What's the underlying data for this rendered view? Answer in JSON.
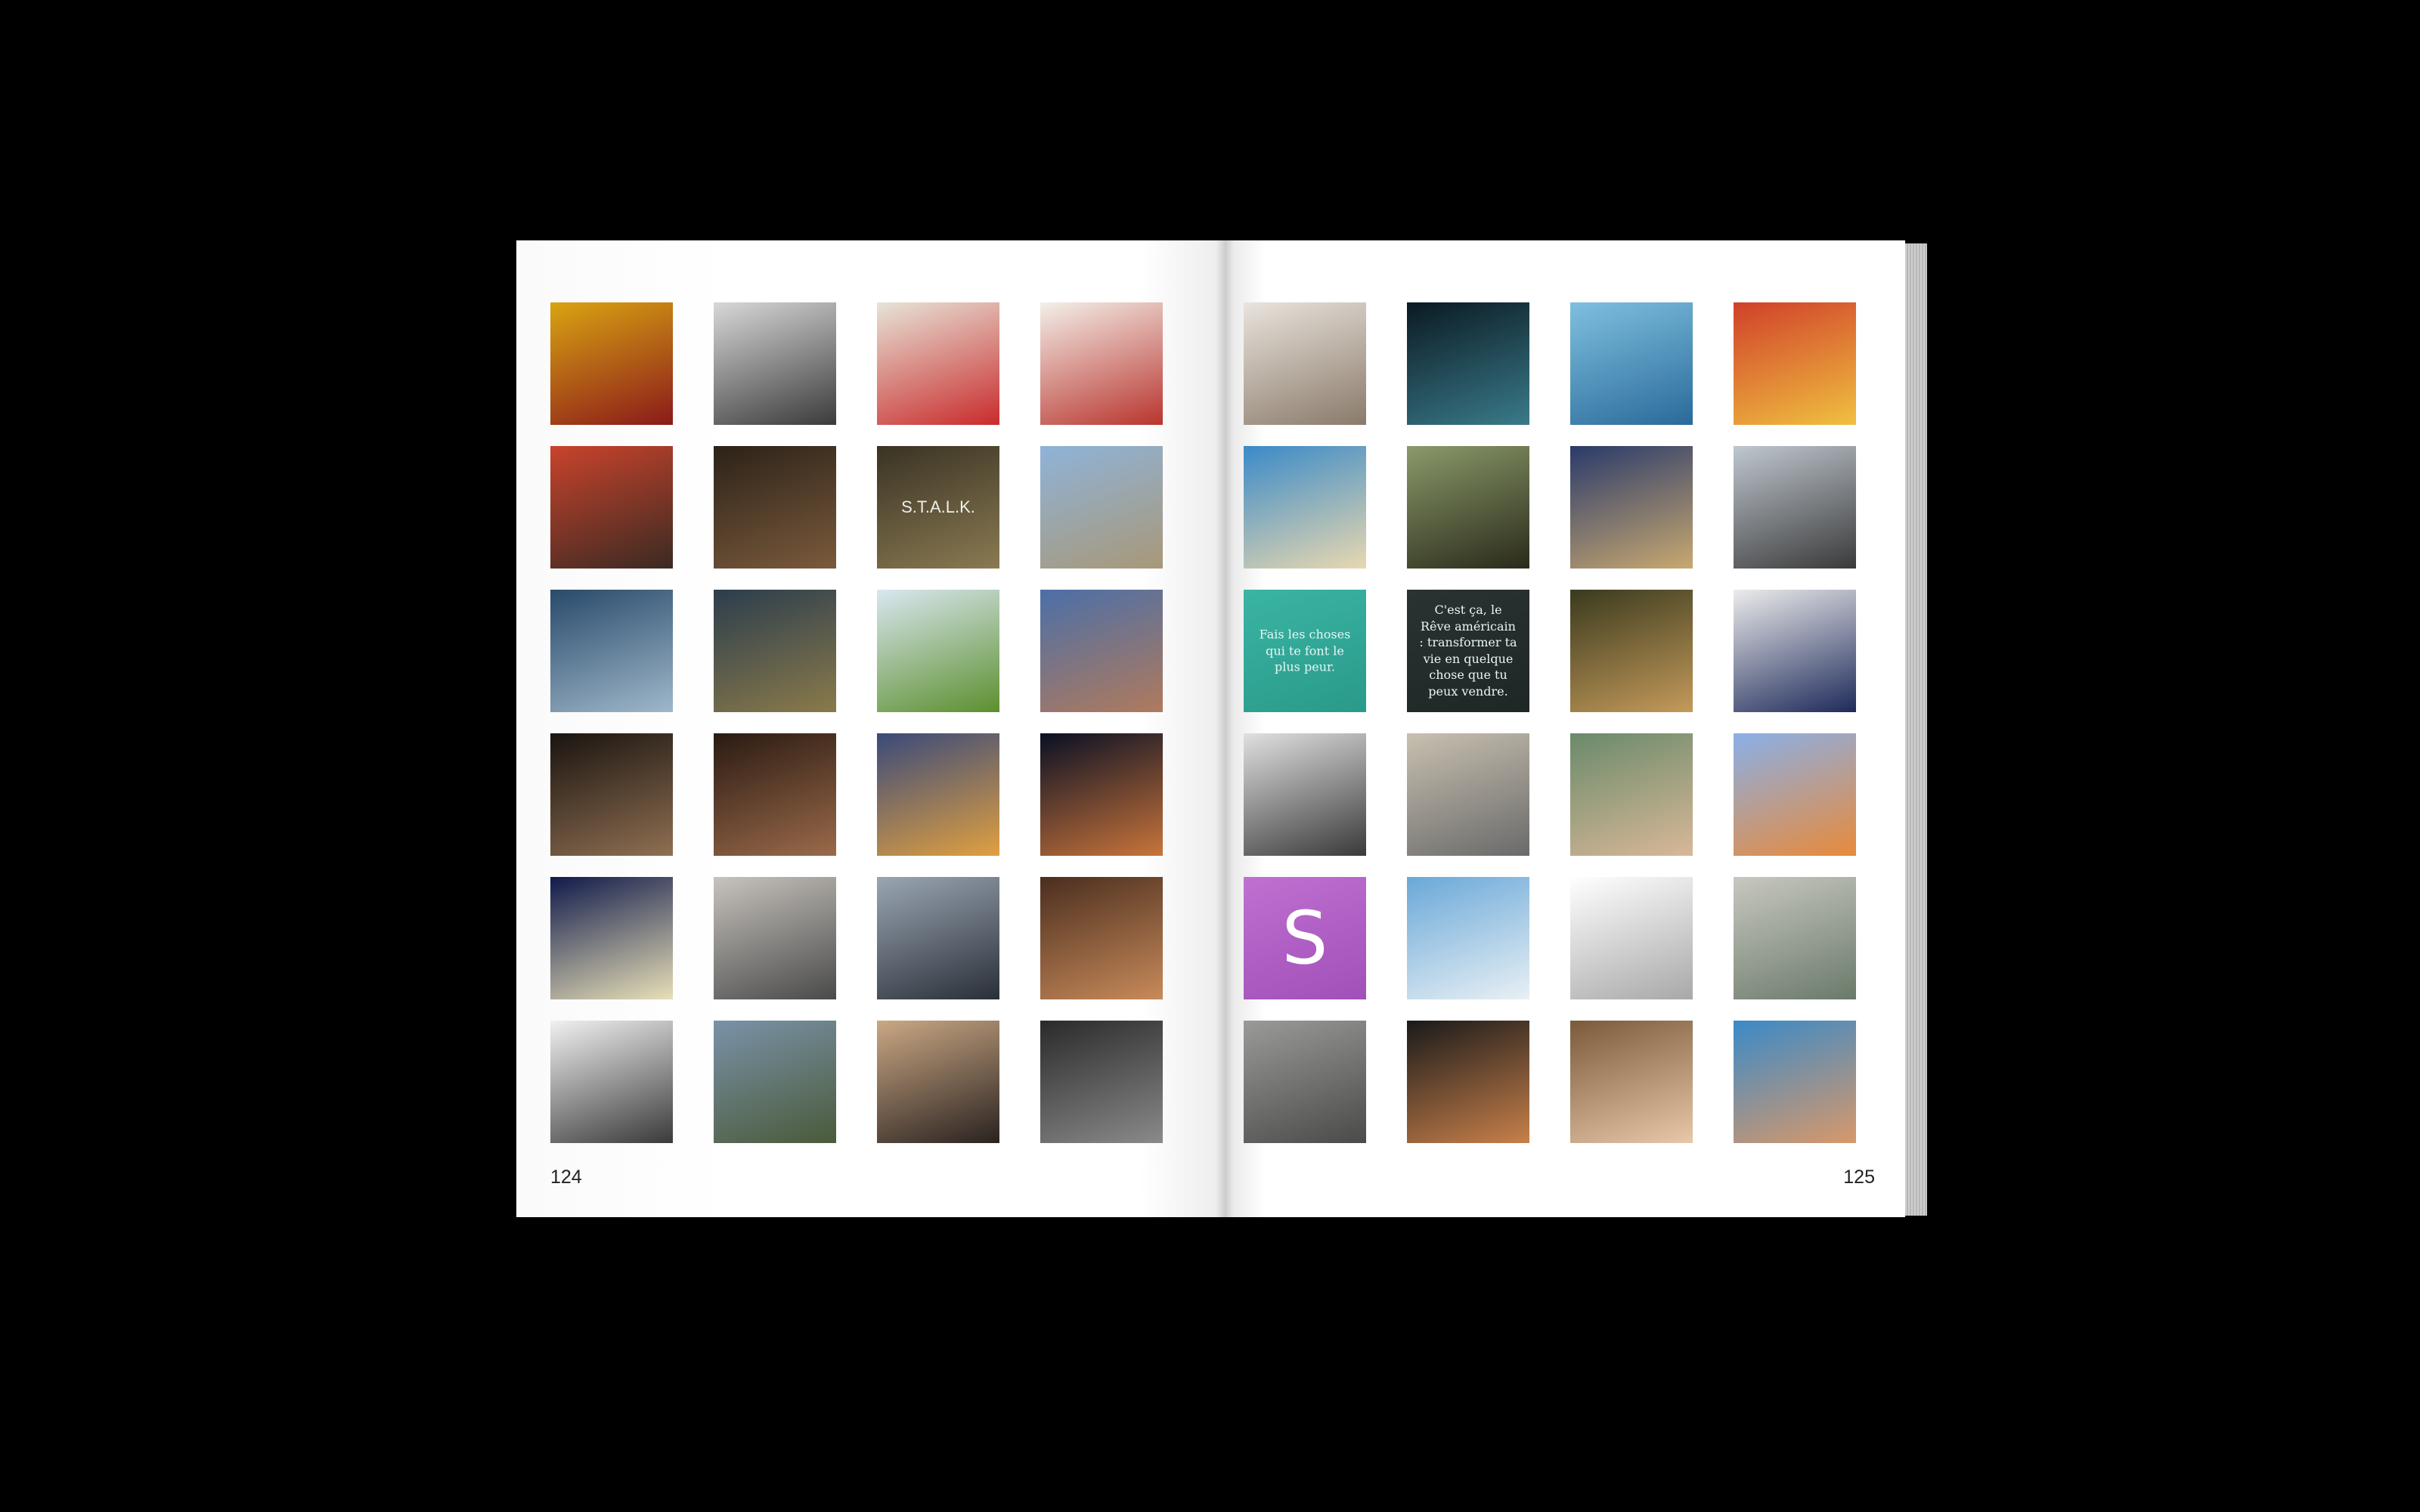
{
  "spread": {
    "left_page": {
      "page_number": "124",
      "thumbnails": [
        {
          "subject": "woman-red-sweater",
          "colors": [
            "#d9a412",
            "#8a1a1a"
          ],
          "glyph": ""
        },
        {
          "subject": "modern-room-interior",
          "colors": [
            "#d8d8d8",
            "#3b3b3b"
          ],
          "glyph": ""
        },
        {
          "subject": "colorful-room-interior",
          "colors": [
            "#e7e4d8",
            "#c92b2b"
          ],
          "glyph": ""
        },
        {
          "subject": "woman-red-phone",
          "colors": [
            "#f4efe9",
            "#b8352e"
          ],
          "glyph": ""
        },
        {
          "subject": "men-red-jackets",
          "colors": [
            "#c9432c",
            "#3a2a22"
          ],
          "glyph": ""
        },
        {
          "subject": "couple-dark-scene",
          "colors": [
            "#2c2218",
            "#7a5a3c"
          ],
          "glyph": ""
        },
        {
          "subject": "stalker-game-cover",
          "colors": [
            "#3a3324",
            "#8a7a52"
          ],
          "glyph": "S.T.A.L.K."
        },
        {
          "subject": "westminster-palace",
          "colors": [
            "#8fb3d9",
            "#a89878"
          ],
          "glyph": ""
        },
        {
          "subject": "stormy-bridge",
          "colors": [
            "#294a6b",
            "#9fb7c9"
          ],
          "glyph": ""
        },
        {
          "subject": "big-ben-dusk",
          "colors": [
            "#2b3d4d",
            "#8a7a4a"
          ],
          "glyph": ""
        },
        {
          "subject": "green-modern-building",
          "colors": [
            "#d9e7f0",
            "#5c8f2e"
          ],
          "glyph": ""
        },
        {
          "subject": "old-building-roof",
          "colors": [
            "#4b6fa8",
            "#b07a5c"
          ],
          "glyph": ""
        },
        {
          "subject": "eye-closeup",
          "colors": [
            "#1a1410",
            "#8f6f52"
          ],
          "glyph": ""
        },
        {
          "subject": "woman-black-hair",
          "colors": [
            "#2a1a12",
            "#9a6a4a"
          ],
          "glyph": ""
        },
        {
          "subject": "paris-night",
          "colors": [
            "#3a4a7a",
            "#e0a040"
          ],
          "glyph": ""
        },
        {
          "subject": "space-galaxy",
          "colors": [
            "#0a1024",
            "#c8743a"
          ],
          "glyph": ""
        },
        {
          "subject": "moon-tree",
          "colors": [
            "#101a4a",
            "#e8e0b8"
          ],
          "glyph": ""
        },
        {
          "subject": "store-front",
          "colors": [
            "#c7c3bd",
            "#4a4a4a"
          ],
          "glyph": ""
        },
        {
          "subject": "store-collage",
          "colors": [
            "#9aa6b3",
            "#2a2f38"
          ],
          "glyph": ""
        },
        {
          "subject": "clothing-shop",
          "colors": [
            "#4a2e1e",
            "#c88a5a"
          ],
          "glyph": ""
        },
        {
          "subject": "fashion-store",
          "colors": [
            "#f1f1f1",
            "#3a3a3a"
          ],
          "glyph": ""
        },
        {
          "subject": "racing-game",
          "colors": [
            "#7a92a8",
            "#4a5a3a"
          ],
          "glyph": ""
        },
        {
          "subject": "man-glasses",
          "colors": [
            "#caa884",
            "#2a2220"
          ],
          "glyph": ""
        },
        {
          "subject": "band-portrait",
          "colors": [
            "#2a2a2a",
            "#8a8a8a"
          ],
          "glyph": ""
        }
      ]
    },
    "right_page": {
      "page_number": "125",
      "thumbnails": [
        {
          "subject": "loft-interior",
          "colors": [
            "#e9e4dd",
            "#8a7a6a"
          ],
          "glyph": ""
        },
        {
          "subject": "couple-city-window",
          "colors": [
            "#0a1a22",
            "#3a7a8a"
          ],
          "glyph": ""
        },
        {
          "subject": "footballer-light-blue",
          "colors": [
            "#7fc0e0",
            "#2a6a9a"
          ],
          "glyph": ""
        },
        {
          "subject": "footballer-spain",
          "colors": [
            "#d0402a",
            "#f0c040"
          ],
          "glyph": ""
        },
        {
          "subject": "beach-coast",
          "colors": [
            "#3a8ac8",
            "#e8d8b0"
          ],
          "glyph": ""
        },
        {
          "subject": "battle-game",
          "colors": [
            "#8a9a6a",
            "#2a2a1a"
          ],
          "glyph": ""
        },
        {
          "subject": "army-battle-game",
          "colors": [
            "#2a3a6a",
            "#c8a870"
          ],
          "glyph": ""
        },
        {
          "subject": "modern-walkway",
          "colors": [
            "#bfc7cf",
            "#3a3a3a"
          ],
          "glyph": ""
        },
        {
          "subject": "quote-teal",
          "colors": [
            "#3ab4a4",
            "#2a9a8a"
          ],
          "glyph": "Fais les choses qui te font le plus peur."
        },
        {
          "subject": "quote-dark",
          "colors": [
            "#2a3232",
            "#1e2626"
          ],
          "glyph": "C'est ça, le Rêve américain : transformer ta vie en quelque chose que tu peux vendre."
        },
        {
          "subject": "mona-lisa",
          "colors": [
            "#3a3a1e",
            "#c49a5a"
          ],
          "glyph": ""
        },
        {
          "subject": "logo-illustration",
          "colors": [
            "#ececec",
            "#1e2a5a"
          ],
          "glyph": ""
        },
        {
          "subject": "woman-bw",
          "colors": [
            "#e0e0e0",
            "#3a3a3a"
          ],
          "glyph": ""
        },
        {
          "subject": "david-statue",
          "colors": [
            "#c8c0b0",
            "#6a6a6a"
          ],
          "glyph": ""
        },
        {
          "subject": "birth-of-venus",
          "colors": [
            "#6a8a6a",
            "#d8b898"
          ],
          "glyph": ""
        },
        {
          "subject": "cat-sunglasses",
          "colors": [
            "#8ab0e8",
            "#e88a3a"
          ],
          "glyph": ""
        },
        {
          "subject": "letter-s-tile",
          "colors": [
            "#c070d0",
            "#a050b8"
          ],
          "glyph": "S"
        },
        {
          "subject": "geyser",
          "colors": [
            "#6aa8d8",
            "#e8f0f4"
          ],
          "glyph": ""
        },
        {
          "subject": "water-tap",
          "colors": [
            "#ffffff",
            "#a8a8a8"
          ],
          "glyph": ""
        },
        {
          "subject": "street-painting",
          "colors": [
            "#c8c8c0",
            "#6a7a6a"
          ],
          "glyph": ""
        },
        {
          "subject": "david-bust",
          "colors": [
            "#9a9a98",
            "#4a4a48"
          ],
          "glyph": ""
        },
        {
          "subject": "greek-vase-eros",
          "colors": [
            "#1a1a1a",
            "#c8804a"
          ],
          "glyph": ""
        },
        {
          "subject": "renaissance-nude",
          "colors": [
            "#7a5a3a",
            "#e8c8a8"
          ],
          "glyph": ""
        },
        {
          "subject": "cherub-painting",
          "colors": [
            "#3a8ac8",
            "#d8986a"
          ],
          "glyph": ""
        }
      ]
    }
  }
}
